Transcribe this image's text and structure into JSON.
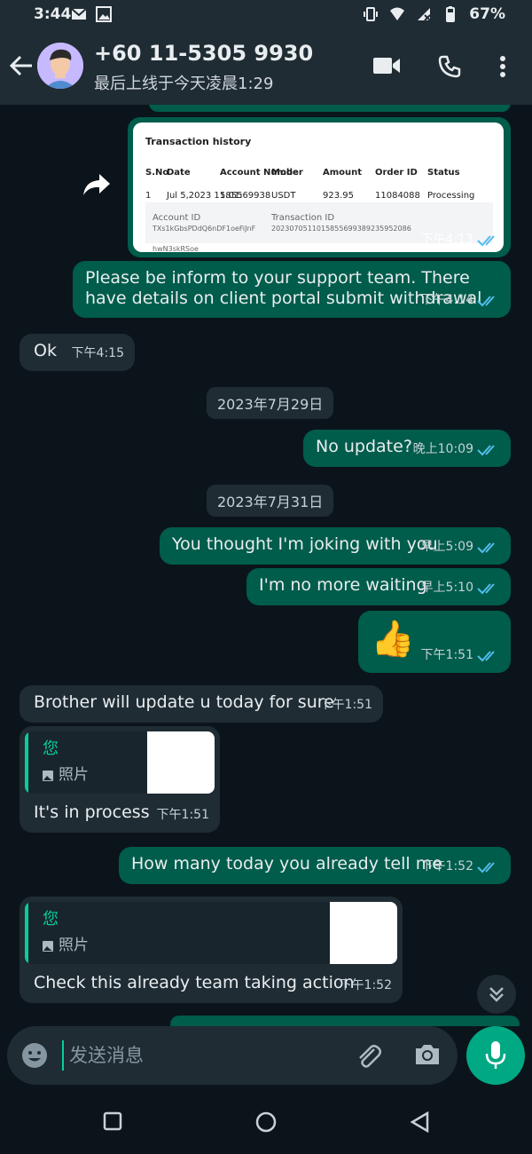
{
  "status": {
    "time": "3:44",
    "battery": "67%"
  },
  "header": {
    "contact": "+60 11-5305 9930",
    "last_seen": "最后上线于今天凌晨1:29"
  },
  "messages": {
    "img_time": "下午4:13",
    "m1_text": "Please be inform to your support team. There have details on client portal submit withdrawal",
    "m1_time": "下午4:14",
    "m2_text": "Ok",
    "m2_time": "下午4:15",
    "date1": "2023年7月29日",
    "m3_text": "No update?",
    "m3_time": "晚上10:09",
    "date2": "2023年7月31日",
    "m4_text": "You thought I'm joking with you",
    "m4_time": "早上5:09",
    "m5_text": "I'm no more waiting",
    "m5_time": "早上5:10",
    "m6_emoji": "👍",
    "m6_time": "下午1:51",
    "m7_text": "Brother will update u today for sure",
    "m7_time": "下午1:51",
    "m8_quote_who": "您",
    "m8_quote_kind": "照片",
    "m8_text": "It's in process",
    "m8_time": "下午1:51",
    "m9_text": "How many today you already tell me",
    "m9_time": "下午1:52",
    "m10_quote_who": "您",
    "m10_quote_kind": "照片",
    "m10_text": "Check this already team taking action",
    "m10_time": "下午1:52"
  },
  "image_preview": {
    "title": "Transaction history",
    "columns": [
      "S.No",
      "Date",
      "Account Number",
      "Mode",
      "Amount",
      "Order ID",
      "Status"
    ],
    "row": [
      "1",
      "Jul 5,2023 11:01:",
      "585569938",
      "USDT",
      "923.95",
      "11084088",
      "Processing"
    ],
    "account_id_label": "Account ID",
    "account_id_value": "TXs1kGbsPDdQ6nDF1oeFiJnFhwN3skRSoe",
    "transaction_id_label": "Transaction ID",
    "transaction_id_value": "2023070511015855699389235952086"
  },
  "composer": {
    "placeholder": "发送消息"
  },
  "colors": {
    "outgoing": "#005c4b",
    "incoming": "#1f2c34",
    "accent": "#00a884",
    "read_ticks": "#53bdeb"
  }
}
